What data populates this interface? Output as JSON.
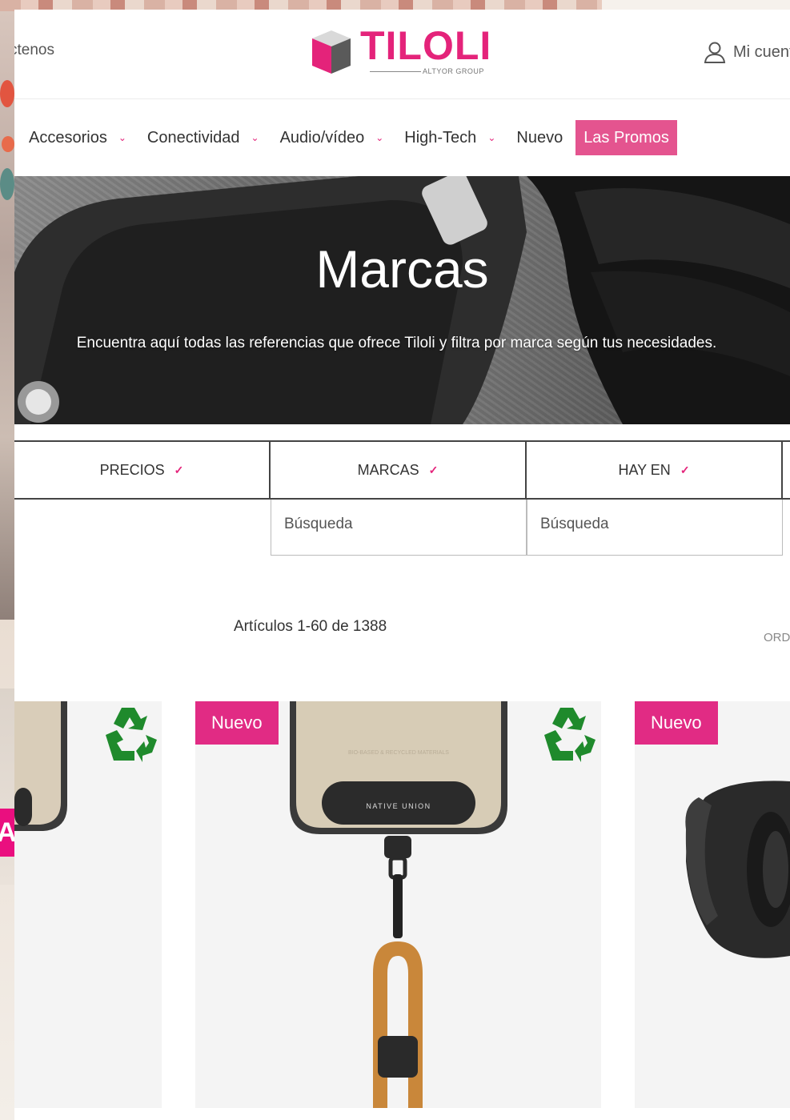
{
  "header": {
    "contact_label": "ctenos",
    "logo": {
      "name": "TILOLI",
      "tagline": "ALTYOR GROUP"
    },
    "account_label": "Mi cuenta"
  },
  "nav": {
    "items": [
      {
        "label": "Accesorios",
        "has_dropdown": true
      },
      {
        "label": "Conectividad",
        "has_dropdown": true
      },
      {
        "label": "Audio/vídeo",
        "has_dropdown": true
      },
      {
        "label": "High-Tech",
        "has_dropdown": true
      },
      {
        "label": "Nuevo",
        "has_dropdown": false
      }
    ],
    "promo_label": "Las Promos"
  },
  "hero": {
    "title": "Marcas",
    "subtitle": "Encuentra aquí todas las referencias que ofrece Tiloli y filtra por marca según tus necesidades."
  },
  "filters": [
    {
      "label": "PRECIOS"
    },
    {
      "label": "MARCAS",
      "search_placeholder": "Búsqueda"
    },
    {
      "label": "HAY EN",
      "search_placeholder": "Búsqueda"
    }
  ],
  "listing": {
    "count_label": "Artículos 1-60 de 1388",
    "sort_label": "ORD"
  },
  "products": [
    {
      "badge": "",
      "recycled": true
    },
    {
      "badge": "Nuevo",
      "recycled": true,
      "brand_text": "NATIVE UNION",
      "material_text": "BIO-BASED & RECYCLED MATERIALS"
    },
    {
      "badge": "Nuevo",
      "recycled": false
    }
  ],
  "background": {
    "pink_tag_text": "A"
  },
  "colors": {
    "brand_pink": "#e4237a",
    "promo_bg": "#e4548f",
    "badge_bg": "#e12b84",
    "recycle_green": "#1f8a2c"
  }
}
